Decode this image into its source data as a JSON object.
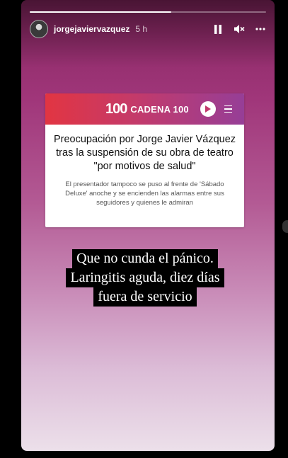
{
  "story": {
    "progress_fraction": 0.6,
    "username": "jorgejaviervazquez",
    "time": "5 h",
    "icons": {
      "pause": "pause-icon",
      "mute": "mute-icon",
      "more": "more-icon"
    }
  },
  "card": {
    "brand": "CADENA 100",
    "brand_mark": "100",
    "title": "Preocupación por Jorge Javier Vázquez tras la suspensión de su obra de teatro \"por motivos de salud\"",
    "subtitle": "El presentador tampoco se puso al frente de 'Sábado Deluxe' anoche y se encienden las alarmas entre sus seguidores y quienes le admiran",
    "colors": {
      "bar_start": "#e23542",
      "bar_end": "#963e97"
    }
  },
  "caption": {
    "lines": [
      "Que no cunda el pánico.",
      "Laringitis aguda, diez días",
      "fuera de servicio"
    ]
  }
}
